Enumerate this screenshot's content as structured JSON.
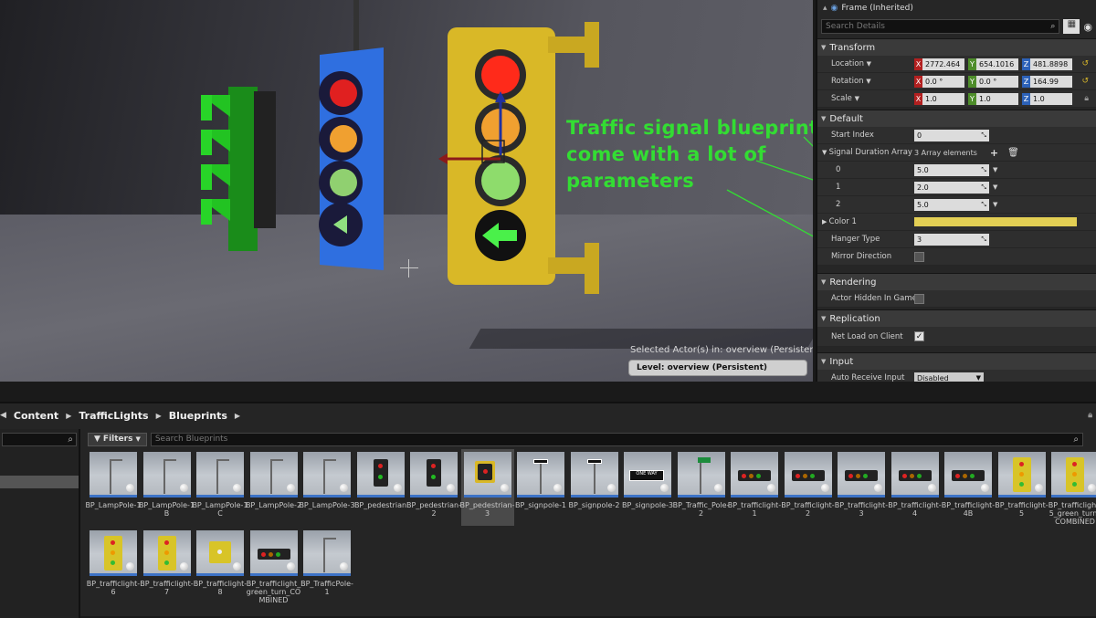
{
  "viewport": {
    "annotation_lines": [
      "Traffic signal blueprints",
      "come with a lot of",
      "parameters"
    ],
    "selected_actor_text": "Selected Actor(s) in:  overview (Persistent)",
    "level_text": "Level:  overview (Persistent)"
  },
  "details": {
    "header": "Frame (Inherited)",
    "search_placeholder": "Search Details",
    "transform": {
      "title": "Transform",
      "location_label": "Location",
      "location": [
        "2772.464",
        "654.1016",
        "481.8898"
      ],
      "rotation_label": "Rotation",
      "rotation": [
        "0.0 °",
        "0.0 °",
        "164.99"
      ],
      "scale_label": "Scale",
      "scale": [
        "1.0",
        "1.0",
        "1.0"
      ]
    },
    "default": {
      "title": "Default",
      "start_index_label": "Start Index",
      "start_index": "0",
      "signal_duration_label": "Signal Duration Array",
      "signal_duration_count": "3 Array elements",
      "elements": [
        {
          "index": "0",
          "value": "5.0"
        },
        {
          "index": "1",
          "value": "2.0"
        },
        {
          "index": "2",
          "value": "5.0"
        }
      ],
      "color_label": "Color 1",
      "color_value": "#e3cf54",
      "hanger_type_label": "Hanger Type",
      "hanger_type": "3",
      "mirror_direction_label": "Mirror Direction"
    },
    "rendering": {
      "title": "Rendering",
      "actor_hidden_label": "Actor Hidden In Game"
    },
    "replication": {
      "title": "Replication",
      "net_load_label": "Net Load on Client"
    },
    "input": {
      "title": "Input",
      "auto_receive_label": "Auto Receive Input",
      "auto_receive_value": "Disabled"
    }
  },
  "content_browser": {
    "breadcrumbs": [
      "Content",
      "TrafficLights",
      "Blueprints"
    ],
    "filters_label": "Filters",
    "search_placeholder": "Search Blueprints",
    "assets": [
      {
        "name": "BP_LampPole-1",
        "kind": "pole"
      },
      {
        "name": "BP_LampPole-1B",
        "kind": "pole"
      },
      {
        "name": "BP_LampPole-1C",
        "kind": "pole"
      },
      {
        "name": "BP_LampPole-2",
        "kind": "pole"
      },
      {
        "name": "BP_LampPole-3",
        "kind": "pole"
      },
      {
        "name": "BP_pedestrian",
        "kind": "ped"
      },
      {
        "name": "BP_pedestrian-2",
        "kind": "ped"
      },
      {
        "name": "BP_pedestrian-3",
        "kind": "ped-yellow"
      },
      {
        "name": "BP_signpole-1",
        "kind": "sign"
      },
      {
        "name": "BP_signpole-2",
        "kind": "sign"
      },
      {
        "name": "BP_signpole-3",
        "kind": "sign-oneway"
      },
      {
        "name": "BP_Traffic_Pole-2",
        "kind": "pole-green"
      },
      {
        "name": "BP_trafficlight-1",
        "kind": "horiz"
      },
      {
        "name": "BP_trafficlight-2",
        "kind": "horiz"
      },
      {
        "name": "BP_trafficlight-3",
        "kind": "horiz"
      },
      {
        "name": "BP_trafficlight-4",
        "kind": "horiz"
      },
      {
        "name": "BP_trafficlight-4B",
        "kind": "horiz"
      },
      {
        "name": "BP_trafficlight-5",
        "kind": "yellow"
      },
      {
        "name": "BP_trafficlight-5_green_turn_COMBINED",
        "kind": "yellow"
      },
      {
        "name": "BP_trafficlight-6",
        "kind": "yellow"
      },
      {
        "name": "BP_trafficlight-7",
        "kind": "yellow"
      },
      {
        "name": "BP_trafficlight-8",
        "kind": "yellow-small"
      },
      {
        "name": "BP_trafficlight_green_turn_COMBINED",
        "kind": "horiz"
      },
      {
        "name": "BP_TrafficPole-1",
        "kind": "pole"
      }
    ],
    "selected_asset": "BP_pedestrian-3"
  }
}
